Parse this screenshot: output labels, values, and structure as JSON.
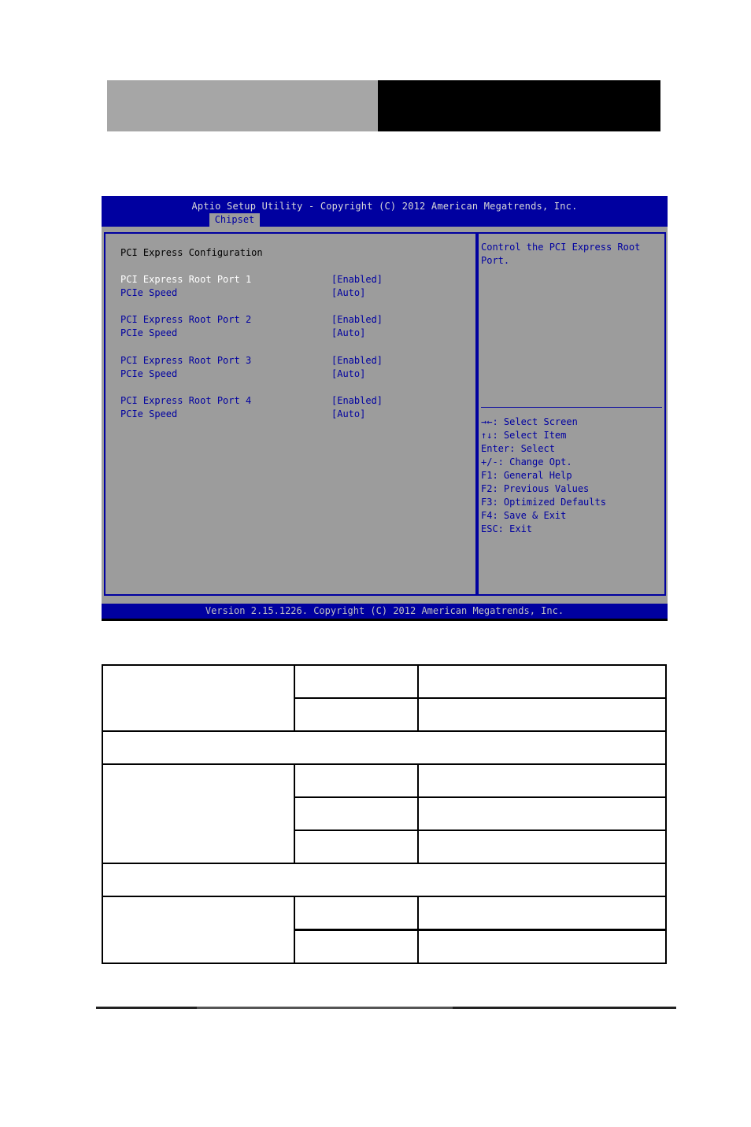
{
  "bios": {
    "title": "Aptio Setup Utility - Copyright (C) 2012 American Megatrends, Inc.",
    "active_tab": "Chipset",
    "section_heading": "PCI Express Configuration",
    "items": [
      {
        "label": "PCI Express Root Port 1",
        "value": "[Enabled]",
        "selected": true
      },
      {
        "label": "PCIe Speed",
        "value": "[Auto]",
        "selected": false
      },
      {
        "label": "PCI Express Root Port 2",
        "value": "[Enabled]",
        "selected": false
      },
      {
        "label": "PCIe Speed",
        "value": "[Auto]",
        "selected": false
      },
      {
        "label": "PCI Express Root Port 3",
        "value": "[Enabled]",
        "selected": false
      },
      {
        "label": "PCIe Speed",
        "value": "[Auto]",
        "selected": false
      },
      {
        "label": "PCI Express Root Port 4",
        "value": "[Enabled]",
        "selected": false
      },
      {
        "label": "PCIe Speed",
        "value": "[Auto]",
        "selected": false
      }
    ],
    "help_text": [
      "Control the PCI Express Root",
      "Port."
    ],
    "key_help": [
      {
        "icon": "left-right-arrows-icon",
        "glyph": "→←",
        "text": ": Select Screen"
      },
      {
        "icon": "up-down-arrows-icon",
        "glyph": "↑↓",
        "text": ": Select Item"
      },
      {
        "icon": "",
        "glyph": "",
        "text": "Enter: Select"
      },
      {
        "icon": "",
        "glyph": "",
        "text": "+/-: Change Opt."
      },
      {
        "icon": "",
        "glyph": "",
        "text": "F1: General Help"
      },
      {
        "icon": "",
        "glyph": "",
        "text": "F2: Previous Values"
      },
      {
        "icon": "",
        "glyph": "",
        "text": "F3: Optimized Defaults"
      },
      {
        "icon": "",
        "glyph": "",
        "text": "F4: Save & Exit"
      },
      {
        "icon": "",
        "glyph": "",
        "text": "ESC: Exit"
      }
    ],
    "version": "Version 2.15.1226. Copyright (C) 2012 American Megatrends, Inc."
  },
  "colors": {
    "bios_blue": "#0000a0",
    "bios_grey": "#9c9c9c",
    "selected_text": "#ffffff",
    "header_grey": "#a6a6a6",
    "header_black": "#000000"
  }
}
